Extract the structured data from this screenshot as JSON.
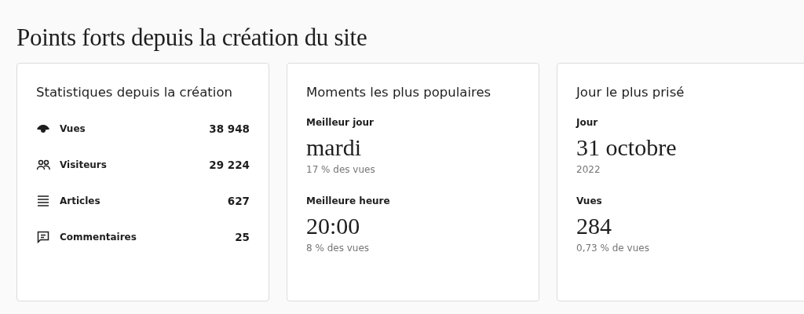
{
  "heading": "Points forts depuis la création du site",
  "cards": [
    {
      "kind": "list",
      "title": "Statistiques depuis la création",
      "rows": [
        {
          "label": "Vues",
          "value": "38 948"
        },
        {
          "label": "Visiteurs",
          "value": "29 224"
        },
        {
          "label": "Articles",
          "value": "627"
        },
        {
          "label": "Commentaires",
          "value": "25"
        }
      ]
    },
    {
      "kind": "metrics",
      "title": "Moments les plus populaires",
      "metrics": [
        {
          "label": "Meilleur jour",
          "value": "mardi",
          "note": "17 % des vues"
        },
        {
          "label": "Meilleure heure",
          "value": "20:00",
          "note": "8 % des vues"
        }
      ]
    },
    {
      "kind": "metrics",
      "title": "Jour le plus prisé",
      "metrics": [
        {
          "label": "Jour",
          "value": "31 octobre",
          "note": "2022"
        },
        {
          "label": "Vues",
          "value": "284",
          "note": "0,73 % de vues"
        }
      ]
    }
  ]
}
